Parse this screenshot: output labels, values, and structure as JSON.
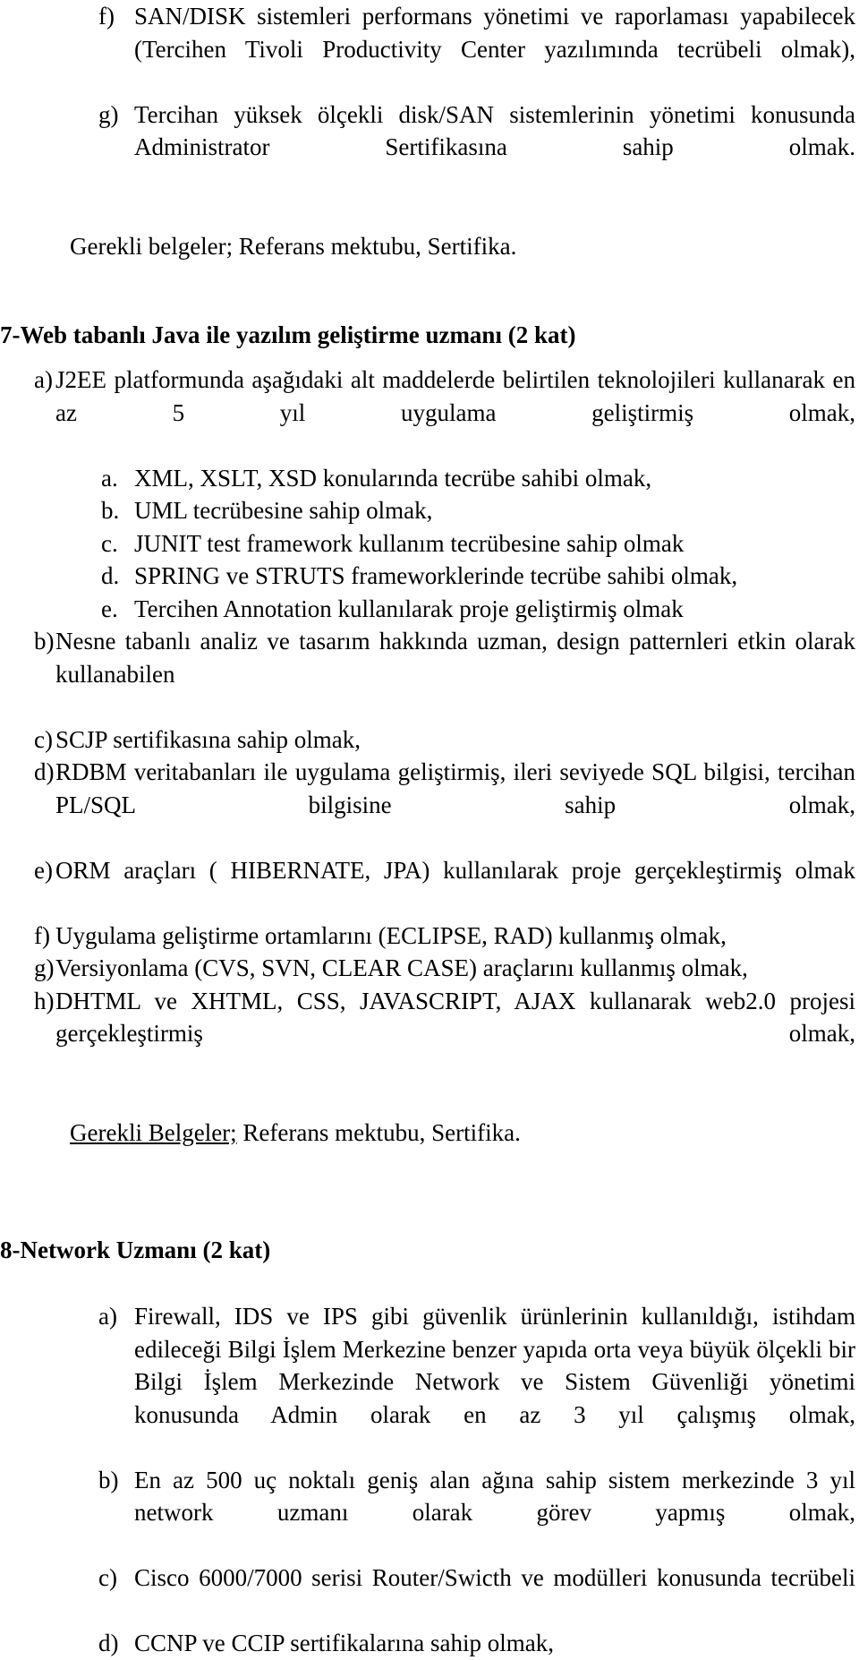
{
  "document": {
    "language": "tr",
    "background_color": "#ffffff",
    "text_color": "#000000"
  },
  "continued_section": {
    "items": [
      {
        "marker": "f)",
        "text": "SAN/DISK sistemleri performans yönetimi ve raporlaması yapabilecek (Tercihen Tivoli Productivity Center yazılımında tecrübeli olmak),"
      },
      {
        "marker": "g)",
        "text": "Tercihan yüksek ölçekli disk/SAN sistemlerinin yönetimi konusunda Administrator Sertifikasına sahip olmak."
      }
    ],
    "note": {
      "underlined_part": "",
      "text": "Gerekli belgeler; Referans mektubu, Sertifika."
    }
  },
  "section_7": {
    "heading": "7-Web tabanlı Java ile yazılım geliştirme uzmanı (2 kat)",
    "items": [
      {
        "marker": "a)",
        "text": "J2EE platformunda aşağıdaki alt maddelerde belirtilen teknolojileri kullanarak en az 5 yıl uygulama geliştirmiş olmak,",
        "subitems": [
          {
            "marker": "a.",
            "text": "XML, XSLT, XSD konularında tecrübe sahibi olmak,"
          },
          {
            "marker": "b.",
            "text": "UML tecrübesine sahip olmak,"
          },
          {
            "marker": "c.",
            "text": "JUNIT test framework kullanım tecrübesine sahip olmak"
          },
          {
            "marker": "d.",
            "text": "SPRING ve STRUTS frameworklerinde tecrübe sahibi olmak,"
          },
          {
            "marker": "e.",
            "text": "Tercihen Annotation kullanılarak proje geliştirmiş olmak"
          }
        ]
      },
      {
        "marker": "b)",
        "text": "Nesne tabanlı analiz ve tasarım hakkında uzman, design patternleri etkin olarak kullanabilen"
      },
      {
        "marker": "c)",
        "text": "SCJP sertifikasına sahip olmak,"
      },
      {
        "marker": "d)",
        "text": "RDBM veritabanları ile uygulama geliştirmiş, ileri seviyede SQL bilgisi, tercihan PL/SQL bilgisine sahip olmak,"
      },
      {
        "marker": "e)",
        "text": "ORM araçları ( HIBERNATE, JPA) kullanılarak proje gerçekleştirmiş olmak"
      },
      {
        "marker": "f)",
        "text": "Uygulama geliştirme ortamlarını (ECLIPSE, RAD) kullanmış olmak,"
      },
      {
        "marker": "g)",
        "text": "Versiyonlama (CVS, SVN, CLEAR CASE) araçlarını kullanmış olmak,"
      },
      {
        "marker": "h)",
        "text": "DHTML ve XHTML, CSS, JAVASCRIPT, AJAX kullanarak web2.0 projesi gerçekleştirmiş olmak,"
      }
    ],
    "note": {
      "underlined_part": "Gerekli Belgeler;",
      "rest": " Referans mektubu, Sertifika."
    }
  },
  "section_8": {
    "heading": "8-Network Uzmanı (2 kat)",
    "items": [
      {
        "marker": "a)",
        "text": "Firewall, IDS ve IPS gibi güvenlik ürünlerinin kullanıldığı, istihdam edileceği Bilgi İşlem Merkezine benzer yapıda orta veya büyük ölçekli bir Bilgi İşlem Merkezinde Network ve Sistem Güvenliği yönetimi konusunda Admin olarak en az 3 yıl çalışmış olmak,"
      },
      {
        "marker": "b)",
        "text": "En az 500 uç noktalı geniş alan ağına sahip sistem merkezinde 3 yıl network uzmanı olarak görev yapmış olmak,"
      },
      {
        "marker": "c)",
        "text": "Cisco 6000/7000 serisi Router/Swicth ve modülleri konusunda tecrübeli"
      },
      {
        "marker": "d)",
        "text": "CCNP ve CCIP sertifikalarına sahip olmak,"
      }
    ]
  }
}
